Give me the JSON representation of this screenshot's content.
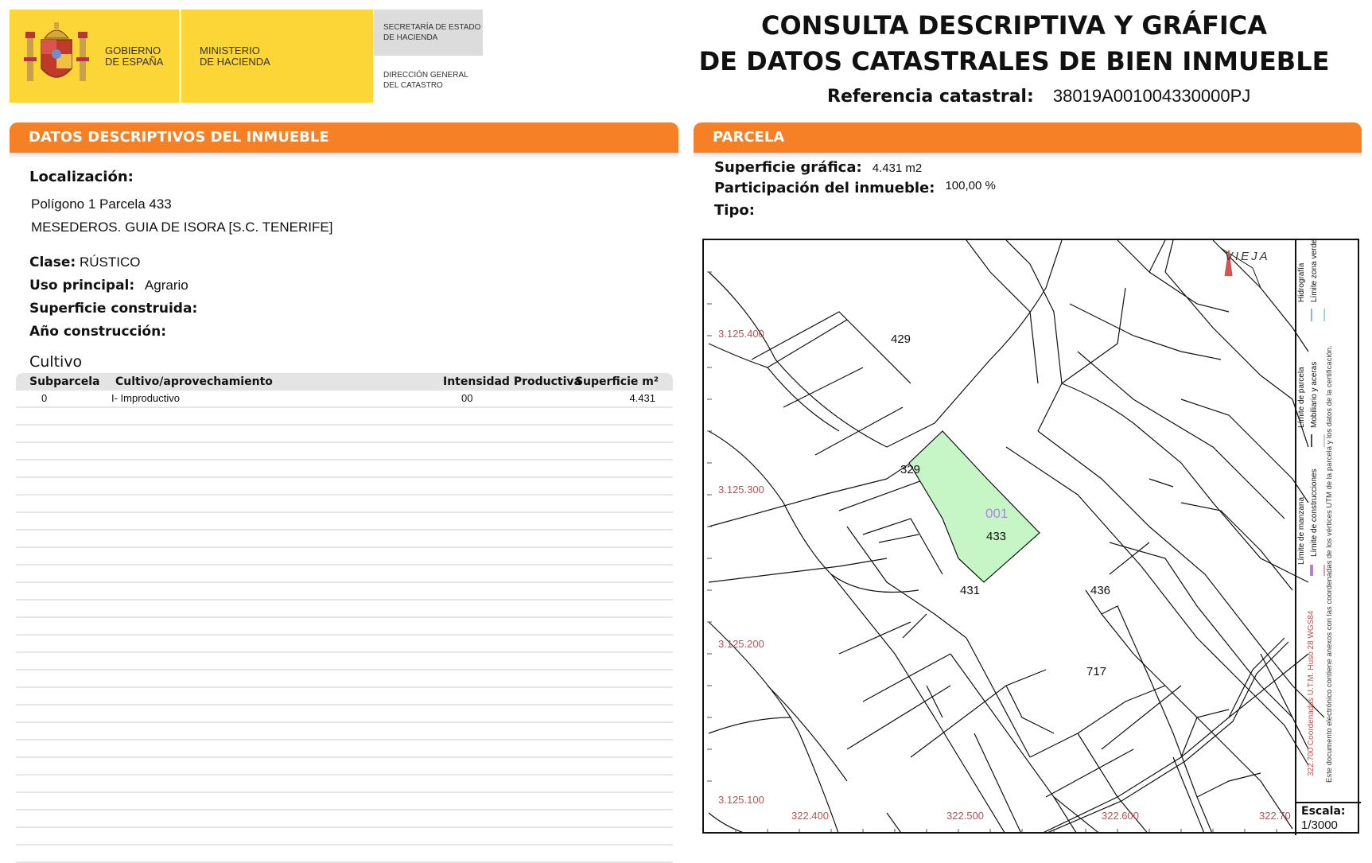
{
  "header": {
    "gov_line1": "GOBIERNO",
    "gov_line2": "DE ESPAÑA",
    "min_line1": "MINISTERIO",
    "min_line2": "DE HACIENDA",
    "sec_line1": "SECRETARÍA DE ESTADO",
    "sec_line2": "DE HACIENDA",
    "dir_line1": "DIRECCIÓN GENERAL",
    "dir_line2": "DEL CATASTRO",
    "title_line1": "CONSULTA DESCRIPTIVA Y GRÁFICA",
    "title_line2": "DE DATOS CATASTRALES DE BIEN INMUEBLE",
    "ref_label": "Referencia catastral:",
    "ref_value": "38019A001004330000PJ"
  },
  "left": {
    "section_title": "DATOS DESCRIPTIVOS DEL INMUEBLE",
    "localizacion_label": "Localización:",
    "localizacion_line1": "Polígono 1 Parcela 433",
    "localizacion_line2": "MESEDEROS. GUIA DE ISORA [S.C. TENERIFE]",
    "clase_label": "Clase:",
    "clase_value": "RÚSTICO",
    "uso_label": "Uso principal:",
    "uso_value": "Agrario",
    "sup_construida_label": "Superficie construida:",
    "anio_label": "Año construcción:",
    "cultivo_title": "Cultivo",
    "table": {
      "headers": [
        "Subparcela",
        "Cultivo/aprovechamiento",
        "Intensidad Productiva",
        "Superficie m²"
      ],
      "rows": [
        [
          "0",
          "I- Improductivo",
          "00",
          "4.431"
        ]
      ]
    }
  },
  "right": {
    "section_title": "PARCELA",
    "sup_grafica_label": "Superficie gráfica:",
    "sup_grafica_value": "4.431 m2",
    "participacion_label": "Participación del inmueble:",
    "participacion_value": "100,00 %",
    "tipo_label": "Tipo:",
    "map": {
      "road_label": "VIEJA",
      "y_coords": [
        "3.125.400",
        "3.125.300",
        "3.125.200",
        "3.125.100"
      ],
      "x_coords": [
        "322.400",
        "322.500",
        "322.600",
        "322.70"
      ],
      "parcel_numbers": [
        "429",
        "329",
        "431",
        "436",
        "717"
      ],
      "subject_code": "001",
      "subject_number": "433",
      "highlight_color": "#c6f5c6",
      "coord_color": "#c0504d"
    },
    "legend": {
      "items": [
        "Límite de manzana",
        "Límite de construcciones",
        "Límite de parcela",
        "Mobiliario y aceras",
        "Hidrografía",
        "Límite zona verde"
      ],
      "coords_note": "322.700 Coordenadas U.T.M. Huso 28 WGS84",
      "doc_note": "Este documento electrónico contiene anexos con las coordenadas de los vértices UTM de la parcela y los datos de la certificación."
    },
    "scale_label": "Escala:",
    "scale_value": "1/3000"
  }
}
